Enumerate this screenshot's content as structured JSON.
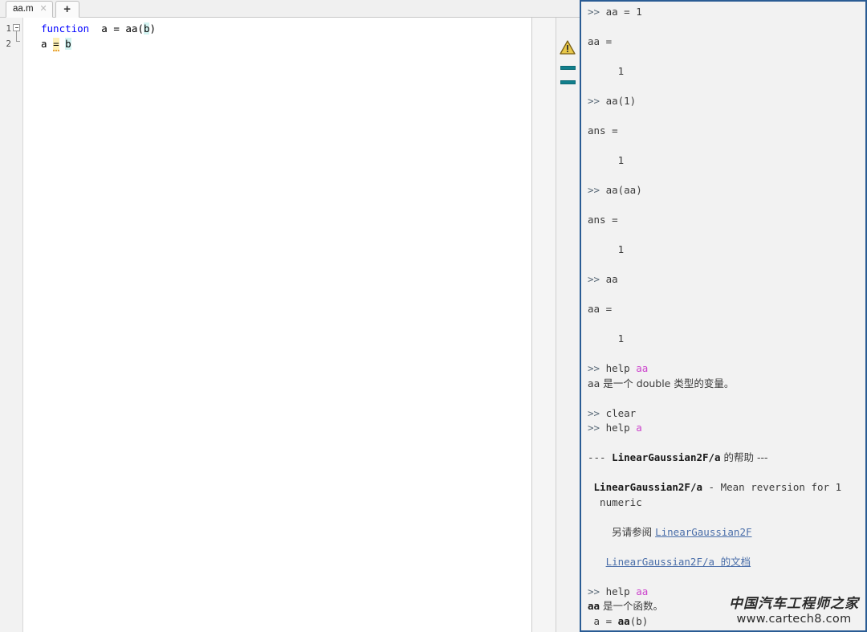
{
  "editor": {
    "tab": {
      "label": "aa.m",
      "close_icon": "close-icon",
      "new_tab_label": "+"
    },
    "gutter": {
      "line_numbers": [
        "1",
        "2"
      ]
    },
    "code": {
      "line1": {
        "keyword": "function",
        "mid": "  a = aa(",
        "highlighted_var": "b",
        "tail": ")"
      },
      "line2": {
        "lhs": "a ",
        "operator": "=",
        "sep": " ",
        "highlighted_var": "b"
      }
    },
    "markers": {
      "warning_icon": "warning-triangle-icon",
      "marker1": "code-analyzer-marker",
      "marker2": "code-analyzer-marker"
    }
  },
  "console": {
    "lines": [
      {
        "id": "l1",
        "type": "cmd",
        "prompt": ">> ",
        "text": "aa = 1"
      },
      {
        "id": "l2",
        "type": "blank",
        "text": ""
      },
      {
        "id": "l3",
        "type": "out",
        "text": "aa ="
      },
      {
        "id": "l4",
        "type": "blank",
        "text": ""
      },
      {
        "id": "l5",
        "type": "out",
        "text": "     1"
      },
      {
        "id": "l6",
        "type": "blank",
        "text": ""
      },
      {
        "id": "l7",
        "type": "cmd",
        "prompt": ">> ",
        "text": "aa(1)"
      },
      {
        "id": "l8",
        "type": "blank",
        "text": ""
      },
      {
        "id": "l9",
        "type": "out",
        "text": "ans ="
      },
      {
        "id": "l10",
        "type": "blank",
        "text": ""
      },
      {
        "id": "l11",
        "type": "out",
        "text": "     1"
      },
      {
        "id": "l12",
        "type": "blank",
        "text": ""
      },
      {
        "id": "l13",
        "type": "cmd",
        "prompt": ">> ",
        "text": "aa(aa)"
      },
      {
        "id": "l14",
        "type": "blank",
        "text": ""
      },
      {
        "id": "l15",
        "type": "out",
        "text": "ans ="
      },
      {
        "id": "l16",
        "type": "blank",
        "text": ""
      },
      {
        "id": "l17",
        "type": "out",
        "text": "     1"
      },
      {
        "id": "l18",
        "type": "blank",
        "text": ""
      },
      {
        "id": "l19",
        "type": "cmd",
        "prompt": ">> ",
        "text": "aa"
      },
      {
        "id": "l20",
        "type": "blank",
        "text": ""
      },
      {
        "id": "l21",
        "type": "out",
        "text": "aa ="
      },
      {
        "id": "l22",
        "type": "blank",
        "text": ""
      },
      {
        "id": "l23",
        "type": "out",
        "text": "     1"
      },
      {
        "id": "l24",
        "type": "blank",
        "text": ""
      }
    ],
    "help_aa_var": {
      "prompt": ">> ",
      "command": "help ",
      "argument": "aa",
      "result": "aa 是一个 double 类型的变量。"
    },
    "clear_cmd": {
      "prompt": ">> ",
      "command": "clear"
    },
    "help_a": {
      "prompt": ">> ",
      "command": "help ",
      "argument": "a"
    },
    "help_block": {
      "header_dash_left": "--- ",
      "header_name": "LinearGaussian2F/a",
      "header_suffix": " 的帮助 ---",
      "desc_name": "LinearGaussian2F/a",
      "desc_body": " - Mean reversion for ",
      "desc_clip": "1",
      "desc_type": "numeric",
      "see_also_label": "另请参阅 ",
      "see_also_link": "LinearGaussian2F",
      "doc_link": "LinearGaussian2F/a 的文档"
    },
    "help_aa_fn": {
      "prompt": ">> ",
      "command": "help ",
      "argument": "aa",
      "result_name": "aa",
      "result_text": " 是一个函数。",
      "signature_pre": " a = ",
      "signature_name": "aa",
      "signature_post": "(b)"
    }
  },
  "watermark": {
    "cn": "中国汽车工程师之家",
    "url": "www.cartech8.com"
  }
}
